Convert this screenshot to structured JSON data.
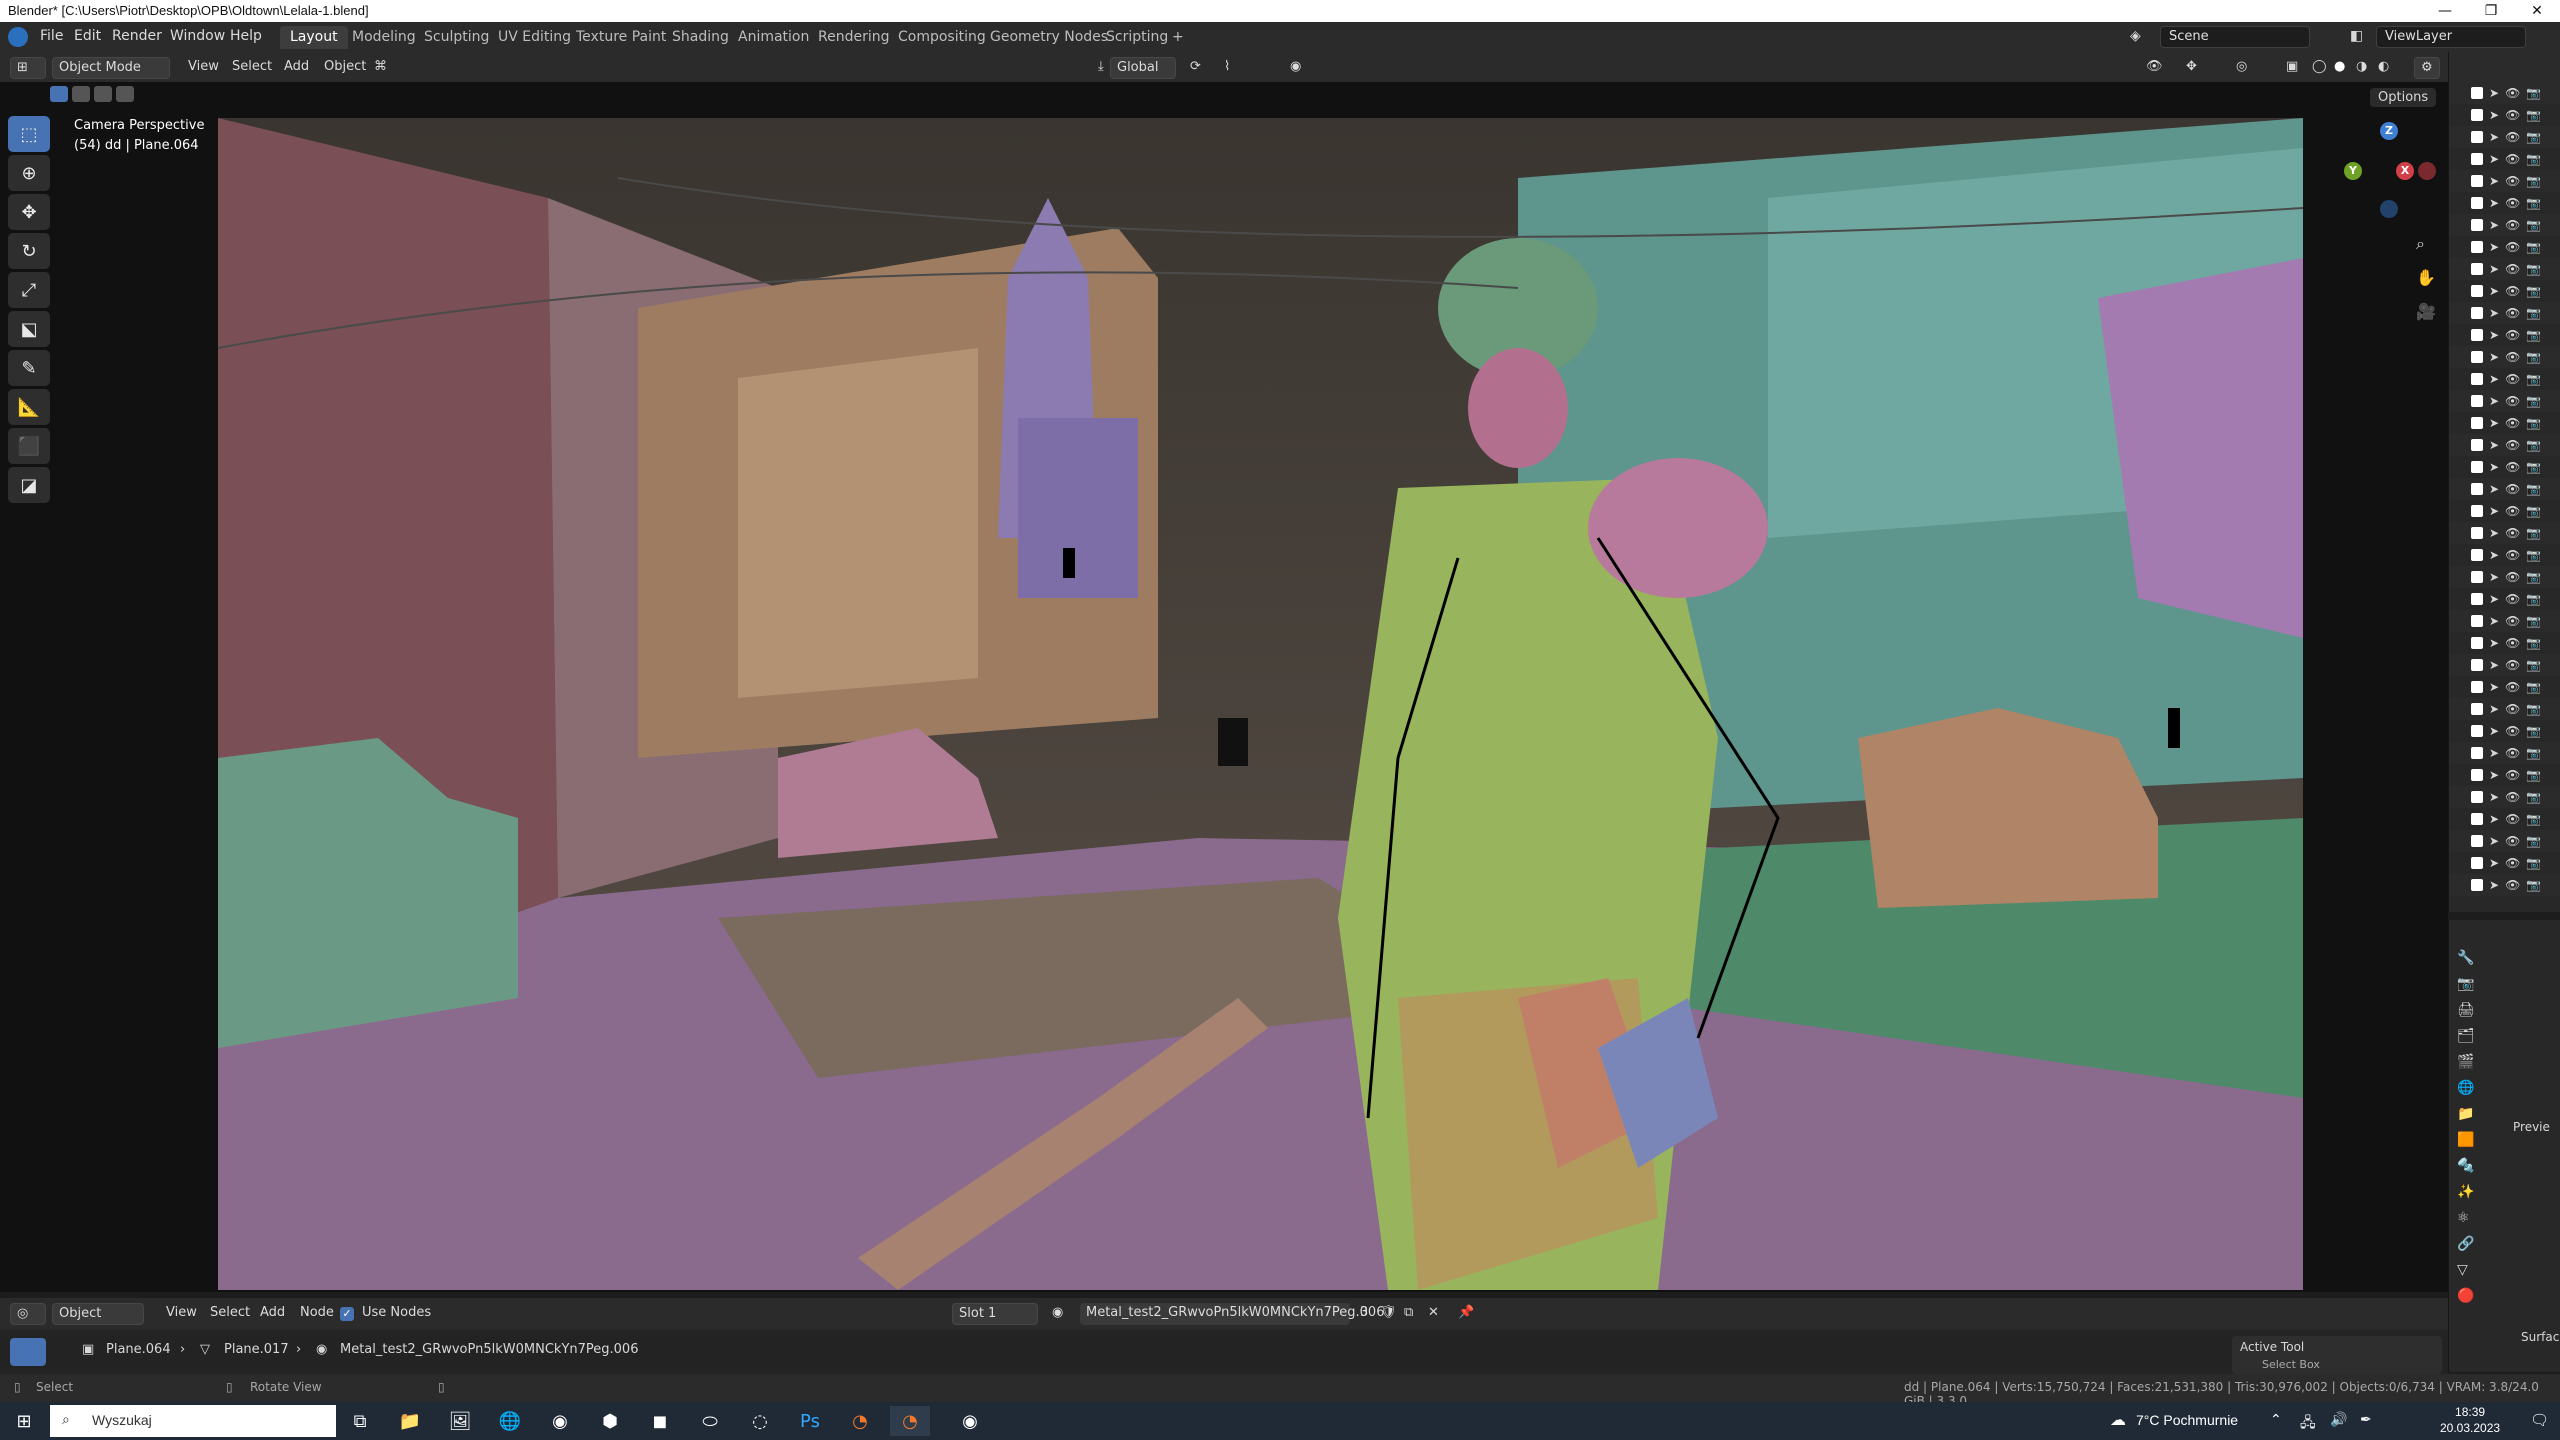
{
  "window": {
    "title": "Blender* [C:\\Users\\Piotr\\Desktop\\OPB\\Oldtown\\Lelala-1.blend]",
    "min_glyph": "—",
    "max_glyph": "❐",
    "close_glyph": "✕"
  },
  "menu": [
    "File",
    "Edit",
    "Render",
    "Window",
    "Help"
  ],
  "workspaces": [
    "Layout",
    "Modeling",
    "Sculpting",
    "UV Editing",
    "Texture Paint",
    "Shading",
    "Animation",
    "Rendering",
    "Compositing",
    "Geometry Nodes",
    "Scripting",
    "+"
  ],
  "scene": {
    "label": "Scene",
    "view_layer": "ViewLayer"
  },
  "viewport_header": {
    "mode": "Object Mode",
    "items": [
      "View",
      "Select",
      "Add",
      "Object"
    ],
    "transform_orientation": "Global",
    "options_label": "Options"
  },
  "viewport": {
    "camera_label": "Camera Perspective",
    "selection_label": "(54) dd | Plane.064"
  },
  "toolbar_tools": [
    "select-box",
    "cursor",
    "move",
    "rotate",
    "scale",
    "transform",
    "annotate",
    "measure",
    "add-cube",
    "shear"
  ],
  "outliner": {
    "row_count": 37
  },
  "shader_header": {
    "editor_type": "Object",
    "items": [
      "View",
      "Select",
      "Add",
      "Node"
    ],
    "use_nodes_label": "Use Nodes",
    "slot": "Slot 1",
    "material": "Metal_test2_GRwvoPn5lkW0MNCkYn7Peg.006",
    "user_count": "3"
  },
  "breadcrumb": {
    "object": "Plane.064",
    "mesh": "Plane.017",
    "material": "Metal_test2_GRwvoPn5lkW0MNCkYn7Peg.006"
  },
  "properties": {
    "preview_label": "Previe",
    "active_tool_label": "Active Tool",
    "select_box_label": "Select Box",
    "surface_label": "Surfac"
  },
  "status": {
    "left_select": "Select",
    "left_rotate": "Rotate View",
    "stats": "dd | Plane.064 | Verts:15,750,724 | Faces:21,531,380 | Tris:30,976,002 | Objects:0/6,734 | VRAM: 3.8/24.0 GiB | 3.3.0"
  },
  "taskbar": {
    "search_placeholder": "Wyszukaj",
    "weather": "7°C  Pochmurnie",
    "time": "18:39",
    "date": "20.03.2023"
  },
  "colors": {
    "accent": "#4772b3",
    "bg": "#1d1d1d",
    "panel": "#2b2b2b"
  }
}
